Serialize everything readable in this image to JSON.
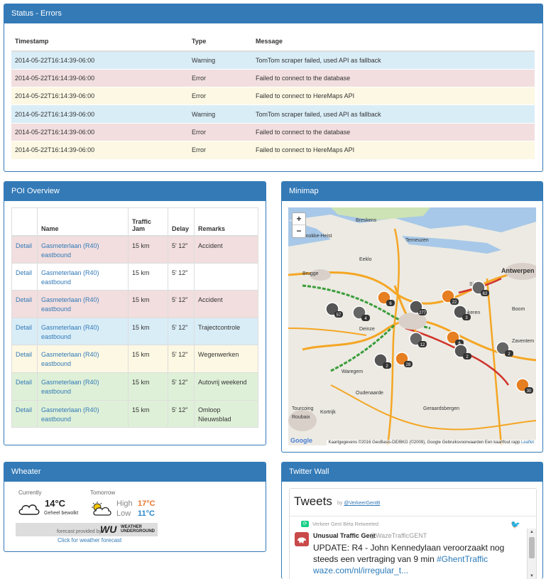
{
  "status": {
    "title": "Status - Errors",
    "headers": [
      "Timestamp",
      "Type",
      "Message"
    ],
    "rows": [
      {
        "ts": "2014-05-22T16:14:39-06:00",
        "type": "Warning",
        "msg": "TomTom scraper failed, used API as fallback"
      },
      {
        "ts": "2014-05-22T16:14:39-06:00",
        "type": "Error",
        "msg": "Failed to connect to the database"
      },
      {
        "ts": "2014-05-22T16:14:39-06:00",
        "type": "Error",
        "msg": "Failed to connect to HereMaps API"
      },
      {
        "ts": "2014-05-22T16:14:39-06:00",
        "type": "Warning",
        "msg": "TomTom scraper failed, used API as fallback"
      },
      {
        "ts": "2014-05-22T16:14:39-06:00",
        "type": "Error",
        "msg": "Failed to connect to the database"
      },
      {
        "ts": "2014-05-22T16:14:39-06:00",
        "type": "Error",
        "msg": "Failed to connect to HereMaps API"
      }
    ]
  },
  "poi": {
    "title": "POI Overview",
    "headers": {
      "detail": "",
      "name": "Name",
      "traffic": "Traffic Jam",
      "delay": "Delay",
      "remarks": "Remarks"
    },
    "rows": [
      {
        "detail": "Detail",
        "name": "Gasmeterlaan (R40) eastbound",
        "jam": "15 km",
        "delay": "5' 12\"",
        "remarks": "Accident"
      },
      {
        "detail": "Detail",
        "name": "Gasmeterlaan (R40) eastbound",
        "jam": "15 km",
        "delay": "5' 12\"",
        "remarks": ""
      },
      {
        "detail": "Detail",
        "name": "Gasmeterlaan (R40) eastbound",
        "jam": "15 km",
        "delay": "5' 12\"",
        "remarks": "Accident"
      },
      {
        "detail": "Detail",
        "name": "Gasmeterlaan (R40) eastbound",
        "jam": "15 km",
        "delay": "5' 12\"",
        "remarks": "Trajectcontrole"
      },
      {
        "detail": "Detail",
        "name": "Gasmeterlaan (R40) eastbound",
        "jam": "15 km",
        "delay": "5' 12\"",
        "remarks": "Wegenwerken"
      },
      {
        "detail": "Detail",
        "name": "Gasmeterlaan (R40) eastbound",
        "jam": "15 km",
        "delay": "5' 12\"",
        "remarks": "Autovrij weekend"
      },
      {
        "detail": "Detail",
        "name": "Gasmeterlaan (R40) eastbound",
        "jam": "15 km",
        "delay": "5' 12\"",
        "remarks": "Omloop Nieuwsblad"
      }
    ]
  },
  "minimap": {
    "title": "Minimap",
    "zoom_in": "+",
    "zoom_out": "−",
    "attribution": "Kaartgegevens ©2016 GeoBasis-DE/BKG (©2009), Google   Gebruiksvoorwaarden   Een kaartfout rapp",
    "leaflet": "Leaflet",
    "google": "Google",
    "places": [
      {
        "name": "Knokke-Heist"
      },
      {
        "name": "Breskens"
      },
      {
        "name": "Terneuzen"
      },
      {
        "name": "Brugge"
      },
      {
        "name": "Eeklo"
      },
      {
        "name": "Antwerpen"
      },
      {
        "name": "Deinze"
      },
      {
        "name": "Waregem"
      },
      {
        "name": "Oudenaarde"
      },
      {
        "name": "Kortrijk"
      },
      {
        "name": "Geraardsbergen"
      },
      {
        "name": "Tourcoing"
      },
      {
        "name": "Roubaix"
      },
      {
        "name": "Boom"
      },
      {
        "name": "Zaventem"
      },
      {
        "name": "Sint-N"
      },
      {
        "name": "Lokeren"
      }
    ],
    "cluster_counts": [
      "57",
      "6",
      "4",
      "277",
      "22",
      "62",
      "3",
      "6",
      "12",
      "2",
      "28",
      "2",
      "2",
      "30"
    ]
  },
  "weather": {
    "title": "Wheater",
    "currently_label": "Currently",
    "current_temp": "14°C",
    "current_desc": "Geheel bewolkt",
    "tomorrow_label": "Tomorrow",
    "high_label": "High",
    "high_temp": "17°C",
    "low_label": "Low",
    "low_temp": "11°C",
    "provider_text": "forecast provided by",
    "provider_logo": "WU",
    "provider_name": "WEATHER UNDERGROUND",
    "link": "Click for weather forecast",
    "colors": {
      "high": "#e8762d",
      "low": "#2a86c8"
    }
  },
  "twitter": {
    "title": "Twitter Wall",
    "widget_title": "Tweets",
    "by": "by",
    "by_handle": "@VerkeerGentB",
    "retweeted": "Verkeer Gent Bèta Retweeted",
    "author": "Unusual Traffic Gent",
    "handle": "@WazeTrafficGENT",
    "text": "UPDATE: R4 - John Kennedylaan veroorzaakt nog steeds een vertraging van 9 min ",
    "hashtag": "#GhentTraffic",
    "link": "waze.com/nl/irregular_t..."
  },
  "colors": {
    "primary": "#337ab7",
    "info": "#d9edf7",
    "danger": "#f2dede",
    "warning": "#fcf8e3",
    "success": "#dff0d8"
  }
}
